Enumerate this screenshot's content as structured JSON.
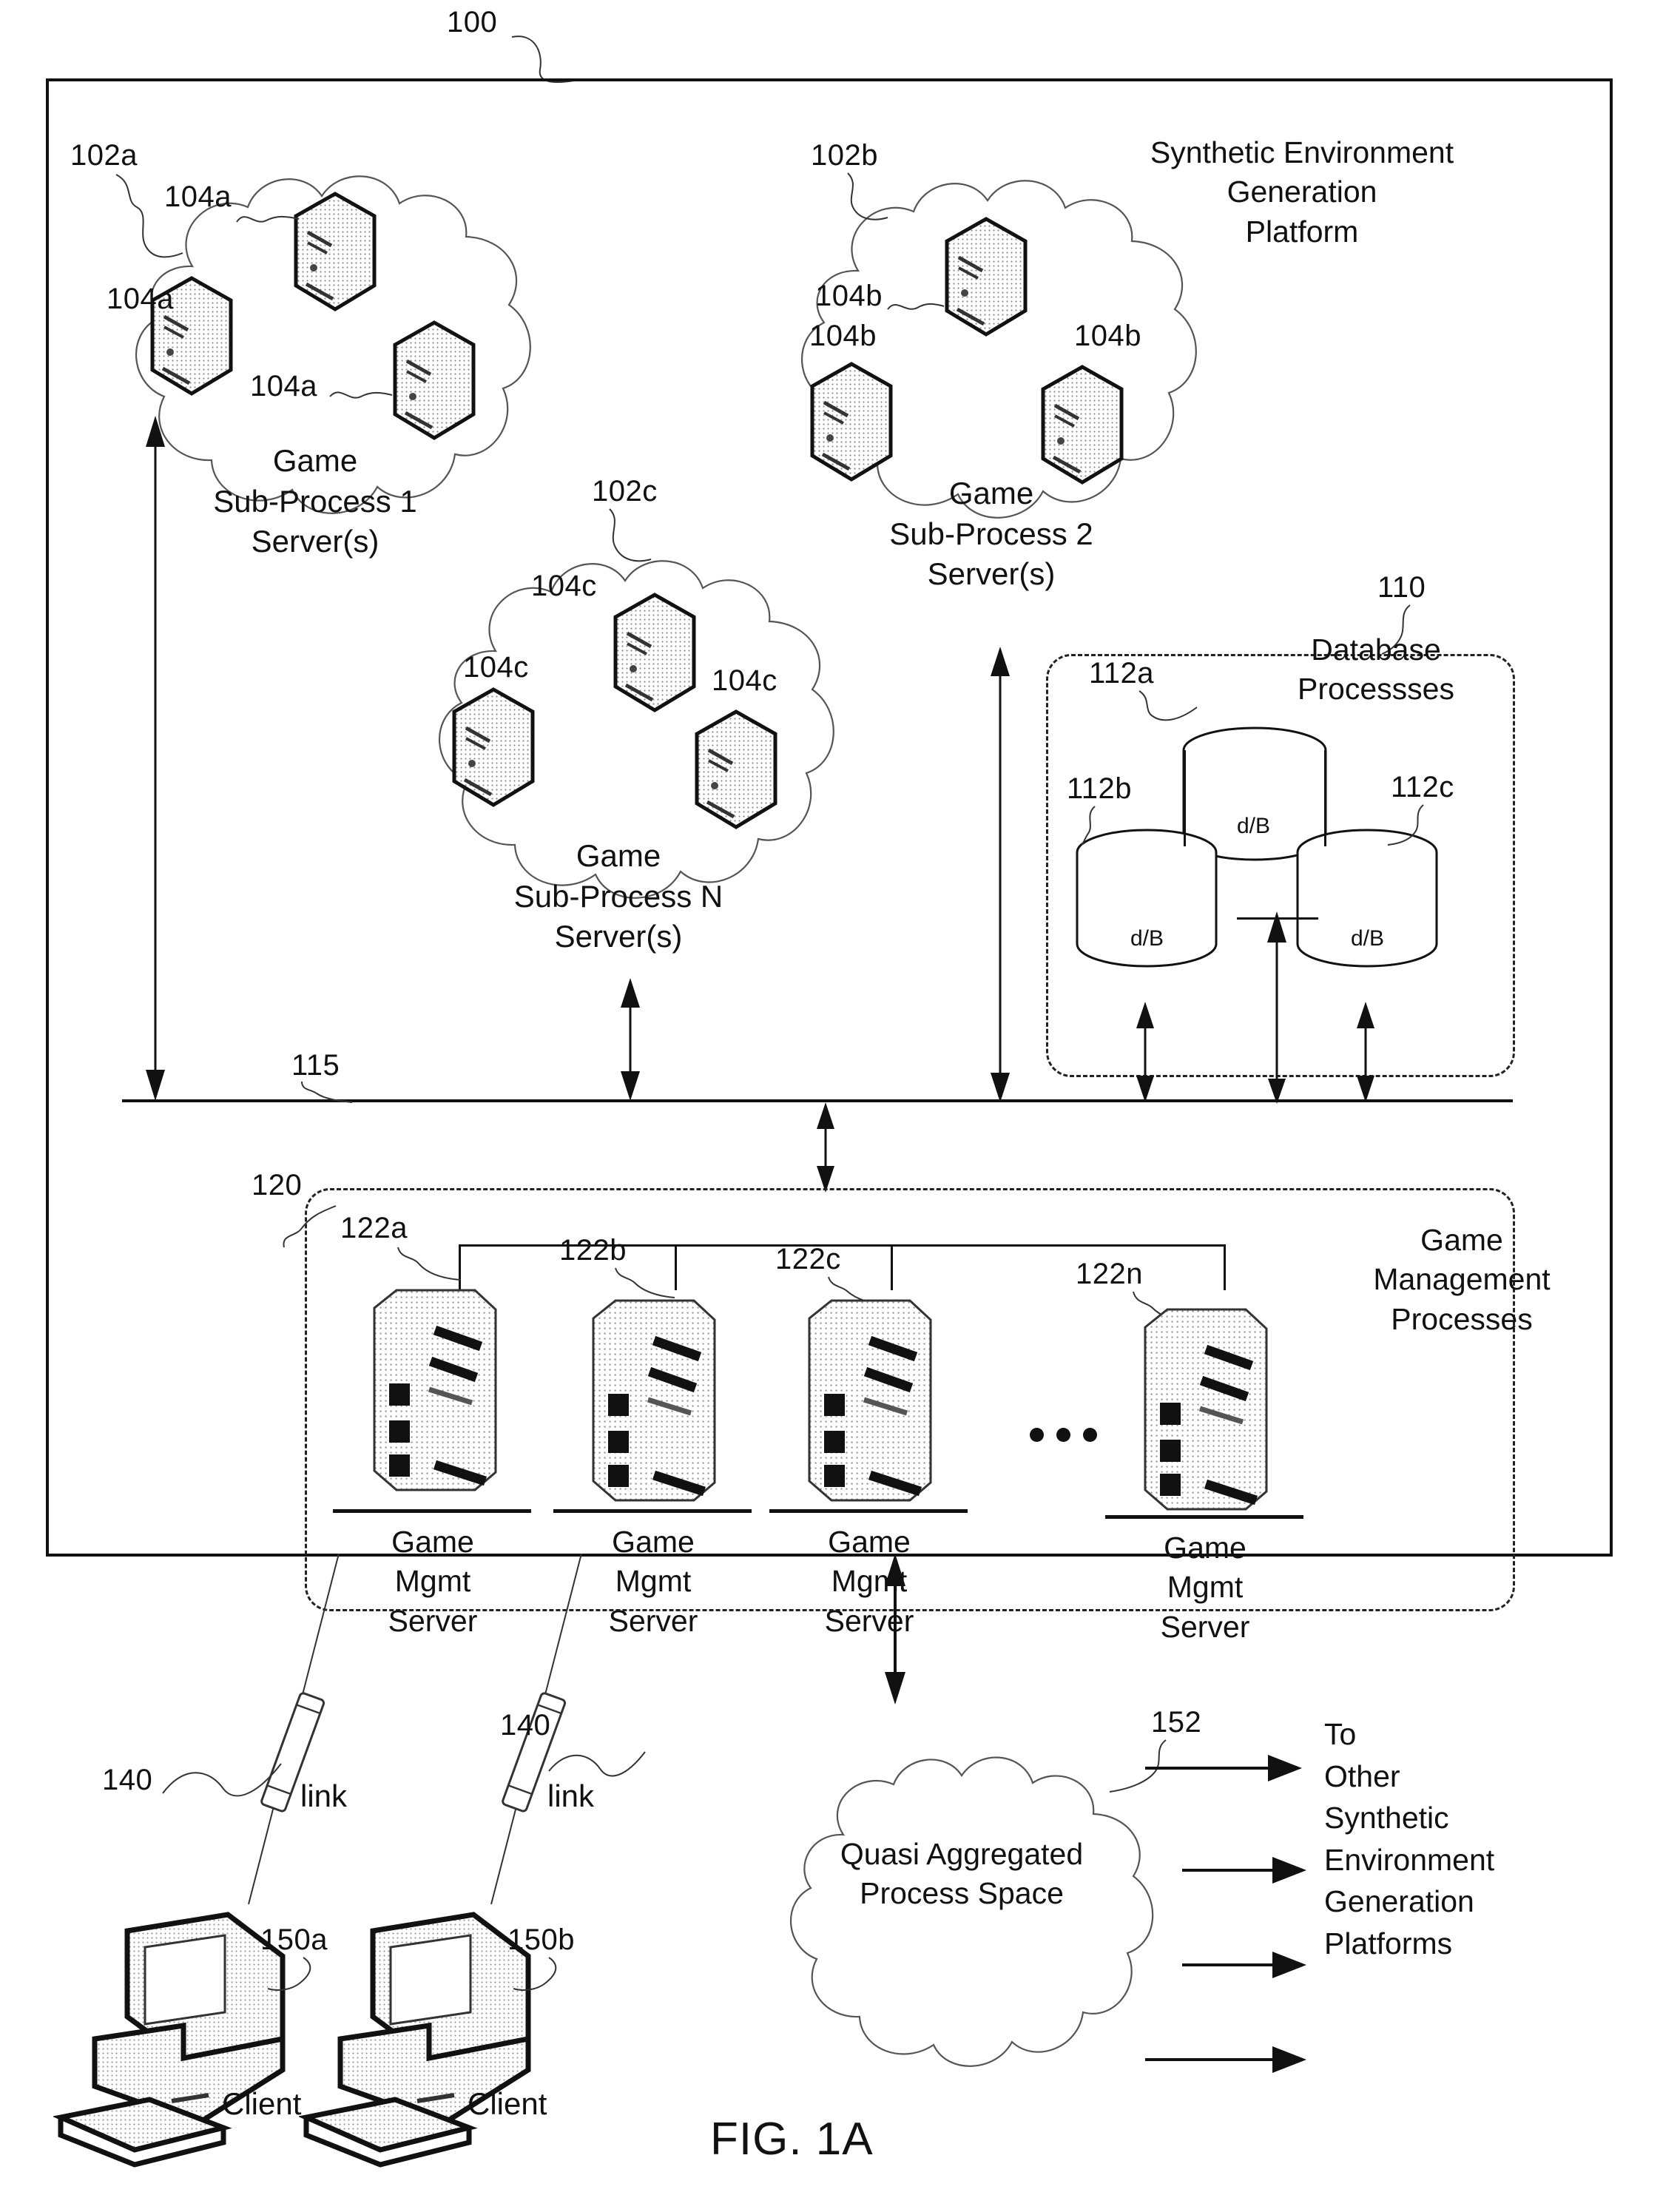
{
  "figure": {
    "caption": "FIG. 1A",
    "platform_ref": "100",
    "platform_title_lines": [
      "Synthetic Environment",
      "Generation",
      "Platform"
    ]
  },
  "subprocess_clouds": [
    {
      "ref": "102a",
      "server_refs": [
        "104a",
        "104a",
        "104a"
      ],
      "title_lines": [
        "Game",
        "Sub-Process 1",
        "Server(s)"
      ]
    },
    {
      "ref": "102b",
      "server_refs": [
        "104b",
        "104b",
        "104b"
      ],
      "title_lines": [
        "Game",
        "Sub-Process 2",
        "Server(s)"
      ]
    },
    {
      "ref": "102c",
      "server_refs": [
        "104c",
        "104c",
        "104c"
      ],
      "title_lines": [
        "Game",
        "Sub-Process N",
        "Server(s)"
      ]
    }
  ],
  "database_group": {
    "ref": "110",
    "title_lines": [
      "Database",
      "Processses"
    ],
    "databases": [
      {
        "ref": "112a",
        "label": "d/B"
      },
      {
        "ref": "112b",
        "label": "d/B"
      },
      {
        "ref": "112c",
        "label": "d/B"
      }
    ]
  },
  "bus": {
    "ref": "115"
  },
  "management_group": {
    "ref": "120",
    "title_lines": [
      "Game",
      "Management",
      "Processes"
    ],
    "ellipsis": "• • •",
    "servers": [
      {
        "ref": "122a",
        "label_lines": [
          "Game",
          "Mgmt",
          "Server"
        ]
      },
      {
        "ref": "122b",
        "label_lines": [
          "Game",
          "Mgmt",
          "Server"
        ]
      },
      {
        "ref": "122c",
        "label_lines": [
          "Game",
          "Mgmt",
          "Server"
        ]
      },
      {
        "ref": "122n",
        "label_lines": [
          "Game",
          "Mgmt",
          "Server"
        ]
      }
    ]
  },
  "clients": [
    {
      "link_ref": "140",
      "link_label": "link",
      "ref": "150a",
      "label": "Client"
    },
    {
      "link_ref": "140",
      "link_label": "link",
      "ref": "150b",
      "label": "Client"
    }
  ],
  "quasi_cloud": {
    "ref": "152",
    "title_lines": [
      "Quasi Aggregated",
      "Process Space"
    ],
    "destination_lines": [
      "To",
      "Other",
      "Synthetic",
      "Environment",
      "Generation",
      "Platforms"
    ],
    "arrow_count": 4
  },
  "colors": {
    "ink": "#111111",
    "line": "#333333",
    "cloud_stroke": "#555555",
    "paper": "#ffffff"
  }
}
